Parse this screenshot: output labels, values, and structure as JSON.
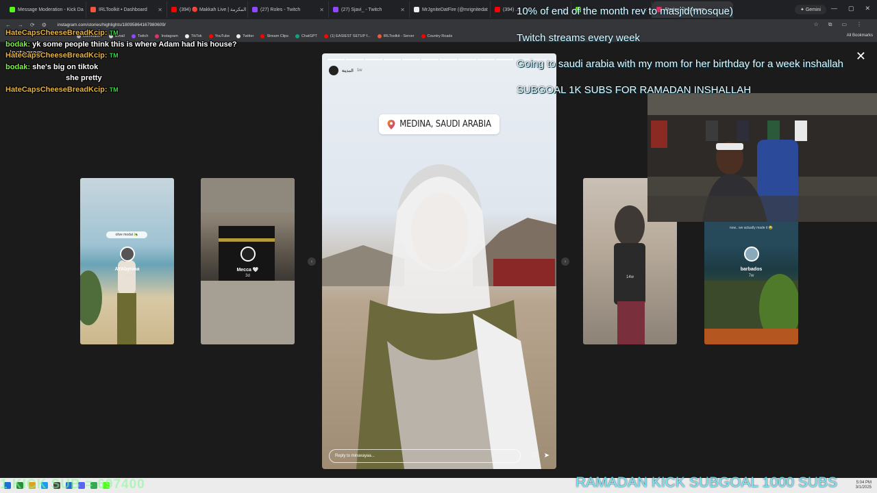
{
  "browser": {
    "tabs": [
      {
        "label": "Message Moderation - Kick Da",
        "color": "#53fc18",
        "active": false
      },
      {
        "label": "IRLToolkit • Dashboard",
        "color": "#f3553c",
        "active": false
      },
      {
        "label": "(394) 🔴 Makkah Live | المكرمة",
        "color": "#ff0000",
        "active": false
      },
      {
        "label": "(27) Roles - Twitch",
        "color": "#9146ff",
        "active": false
      },
      {
        "label": "(27) Sjavi_ - Twitch",
        "color": "#9146ff",
        "active": false
      },
      {
        "label": "MrJgniteDatFire (@mrignitedat",
        "color": "#eeeeee",
        "active": false
      },
      {
        "label": "(394) ...",
        "color": "#ff0000",
        "active": false
      },
      {
        "label": "...",
        "color": "#53fc18",
        "active": false
      },
      {
        "label": "Stories • Instagram",
        "color": "#e1306c",
        "active": true
      }
    ],
    "gemini_label": "Gemini",
    "url": "instagram.com/stories/highlights/18095864167980609/",
    "bookmarks": [
      {
        "label": "Commands",
        "color": "#aaaaaa"
      },
      {
        "label": "Email",
        "color": "#cccccc"
      },
      {
        "label": "Twitch",
        "color": "#9146ff"
      },
      {
        "label": "Instagram",
        "color": "#e1306c"
      },
      {
        "label": "TikTok",
        "color": "#eeeeee"
      },
      {
        "label": "YouTube",
        "color": "#ff0000"
      },
      {
        "label": "Twitter",
        "color": "#eeeeee"
      },
      {
        "label": "Stream Clips",
        "color": "#ff0000"
      },
      {
        "label": "ChatGPT",
        "color": "#10a37f"
      },
      {
        "label": "(1) EASIEST SETUP f...",
        "color": "#ff0000"
      },
      {
        "label": "IRLToolkit - Server",
        "color": "#f3553c"
      },
      {
        "label": "Country Roads",
        "color": "#ff0000"
      }
    ],
    "all_bookmarks": "All Bookmarks"
  },
  "instagram": {
    "logo_text": "Instagram",
    "thumbs": [
      {
        "label": "AYAbynina",
        "age": "4w"
      },
      {
        "label": "Mecca 🤍",
        "age": "3d"
      },
      {
        "label": "",
        "age": "14w"
      },
      {
        "label": "barbados",
        "age": "7w"
      }
    ],
    "thumb_caption_1": "olive modal 🫒",
    "thumb_caption_4": "now.. we actually made it 😂",
    "main_story": {
      "user": "المدينة",
      "ago": "1w",
      "location": "MEDINA, SAUDI ARABIA",
      "reply_placeholder": "Reply to minaxayaa...",
      "progress_total": 12,
      "progress_done": 10
    }
  },
  "chat": [
    {
      "user": "HateCapsCheeseBreadKcip",
      "sep": ":",
      "msg": "",
      "color": "#e8b33c",
      "tm": "TM"
    },
    {
      "user": "bodak",
      "sep": ":",
      "msg": "yk some people think this is where Adam had his house?",
      "color": "#7cf24a",
      "tm": ""
    },
    {
      "user": "HateCapsCheeseBreadKcip",
      "sep": ":",
      "msg": "",
      "color": "#e8b33c",
      "tm": "TM"
    },
    {
      "user": "bodak",
      "sep": ":",
      "msg": "she's big on tiktok",
      "color": "#7cf24a",
      "tm": ""
    },
    {
      "user": "",
      "sep": "",
      "msg": "she pretty",
      "color": "#ffffff",
      "tm": ""
    },
    {
      "user": "HateCapsCheeseBreadKcip",
      "sep": ":",
      "msg": "",
      "color": "#e8b33c",
      "tm": "TM"
    }
  ],
  "overlay": {
    "goal_1": "10% of end of the month rev to masjid(mosque)",
    "goal_2": "Twitch streams every week",
    "goal_3": "Going to saudi arabia with my mom for her birthday for a week inshallah",
    "goal_4": "SUBGOAL 1K SUBS FOR RAMADAN INSHALLAH",
    "ticker_right": "RAMADAN KICK SUBGOAL 1000 SUBS",
    "ticker_left": "1 KICK SUB = 697400"
  },
  "taskbar": {
    "clock_time": "5:04 PM",
    "clock_date": "3/1/2025"
  }
}
